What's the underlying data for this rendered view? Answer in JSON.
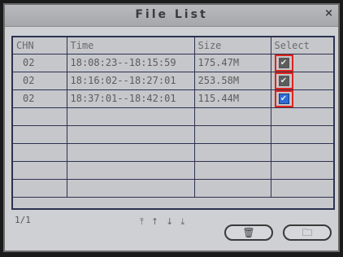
{
  "dialog": {
    "title": "File List",
    "close_icon": "close-icon"
  },
  "table": {
    "headers": [
      "CHN",
      "Time",
      "Size",
      "Select"
    ],
    "rows": [
      {
        "chn": "02",
        "time": "18:08:23--18:15:59",
        "size": "175.47M",
        "selected": true,
        "active": false
      },
      {
        "chn": "02",
        "time": "18:16:02--18:27:01",
        "size": "253.58M",
        "selected": true,
        "active": false
      },
      {
        "chn": "02",
        "time": "18:37:01--18:42:01",
        "size": "115.44M",
        "selected": true,
        "active": true
      }
    ],
    "empty_rows": 5
  },
  "footer": {
    "page": "1/1",
    "nav_icons": [
      "first-page-icon",
      "prev-page-icon",
      "next-page-icon",
      "last-page-icon"
    ],
    "buttons": [
      {
        "icon": "delete-icon"
      },
      {
        "icon": "backup-icon"
      }
    ]
  },
  "colors": {
    "highlight": "#e0241c",
    "active_checkbox": "#2c6cd6"
  }
}
